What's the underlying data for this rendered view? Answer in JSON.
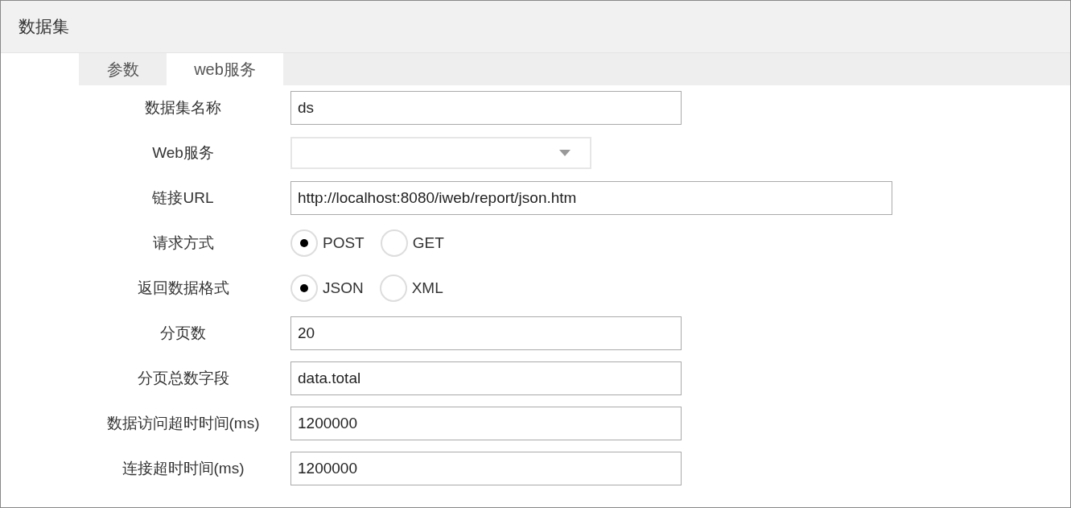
{
  "window": {
    "title": "数据集"
  },
  "tabs": [
    {
      "label": "参数",
      "selected": false
    },
    {
      "label": "web服务",
      "selected": true
    }
  ],
  "form": {
    "rows": [
      {
        "kind": "text",
        "label": "数据集名称",
        "value": "ds"
      },
      {
        "kind": "select",
        "label": "Web服务"
      },
      {
        "kind": "long_text",
        "label": "链接URL",
        "value": "http://localhost:8080/iweb/report/json.htm"
      },
      {
        "kind": "radio",
        "label": "请求方式",
        "options": [
          {
            "label": "POST",
            "selected": true
          },
          {
            "label": "GET",
            "selected": false
          }
        ]
      },
      {
        "kind": "radio",
        "label": "返回数据格式",
        "options": [
          {
            "label": "JSON",
            "selected": true
          },
          {
            "label": "XML",
            "selected": false
          }
        ]
      },
      {
        "kind": "text",
        "label": "分页数",
        "value": "20"
      },
      {
        "kind": "text",
        "label": "分页总数字段",
        "value": "data.total"
      },
      {
        "kind": "text",
        "label": "数据访问超时时间(ms)",
        "value": "1200000"
      },
      {
        "kind": "text",
        "label": "连接超时时间(ms)",
        "value": "1200000"
      }
    ]
  }
}
